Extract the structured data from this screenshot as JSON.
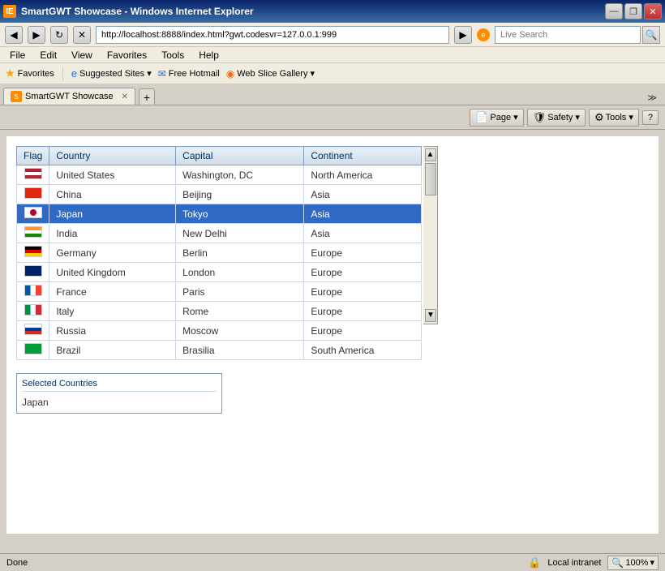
{
  "window": {
    "title": "SmartGWT Showcase - Windows Internet Explorer",
    "tab_label": "SmartGWT Showcase",
    "icon": "🔶"
  },
  "titlebar": {
    "minimize": "—",
    "restore": "❐",
    "close": "✕"
  },
  "menubar": {
    "items": [
      "File",
      "Edit",
      "View",
      "Favorites",
      "Tools",
      "Help"
    ]
  },
  "addressbar": {
    "back": "◀",
    "forward": "▶",
    "refresh": "↻",
    "stop": "✕",
    "url": "http://localhost:8888/index.html?gwt.codesvr=127.0.0.1:999",
    "search_placeholder": "Live Search"
  },
  "favoritesbar": {
    "items": [
      {
        "label": "Favorites",
        "icon": "⭐"
      },
      {
        "label": "Suggested Sites ▾",
        "icon": "🌐"
      },
      {
        "label": "Free Hotmail",
        "icon": "✉"
      },
      {
        "label": "Web Slice Gallery ▾",
        "icon": "📋"
      }
    ]
  },
  "toolbar": {
    "page_label": "Page ▾",
    "safety_label": "Safety ▾",
    "tools_label": "Tools ▾",
    "help_label": "?"
  },
  "grid": {
    "columns": [
      "Flag",
      "Country",
      "Capital",
      "Continent"
    ],
    "rows": [
      {
        "flag": "us",
        "country": "United States",
        "capital": "Washington, DC",
        "continent": "North America",
        "selected": false
      },
      {
        "flag": "cn",
        "country": "China",
        "capital": "Beijing",
        "continent": "Asia",
        "selected": false
      },
      {
        "flag": "jp",
        "country": "Japan",
        "capital": "Tokyo",
        "continent": "Asia",
        "selected": true
      },
      {
        "flag": "in",
        "country": "India",
        "capital": "New Delhi",
        "continent": "Asia",
        "selected": false
      },
      {
        "flag": "de",
        "country": "Germany",
        "capital": "Berlin",
        "continent": "Europe",
        "selected": false
      },
      {
        "flag": "gb",
        "country": "United Kingdom",
        "capital": "London",
        "continent": "Europe",
        "selected": false
      },
      {
        "flag": "fr",
        "country": "France",
        "capital": "Paris",
        "continent": "Europe",
        "selected": false
      },
      {
        "flag": "it",
        "country": "Italy",
        "capital": "Rome",
        "continent": "Europe",
        "selected": false
      },
      {
        "flag": "ru",
        "country": "Russia",
        "capital": "Moscow",
        "continent": "Europe",
        "selected": false
      },
      {
        "flag": "br",
        "country": "Brazil",
        "capital": "Brasilia",
        "continent": "South America",
        "selected": false
      }
    ]
  },
  "selected_countries": {
    "label": "Selected Countries",
    "value": "Japan"
  },
  "statusbar": {
    "status": "Done",
    "zone": "Local intranet",
    "zoom": "100%"
  }
}
